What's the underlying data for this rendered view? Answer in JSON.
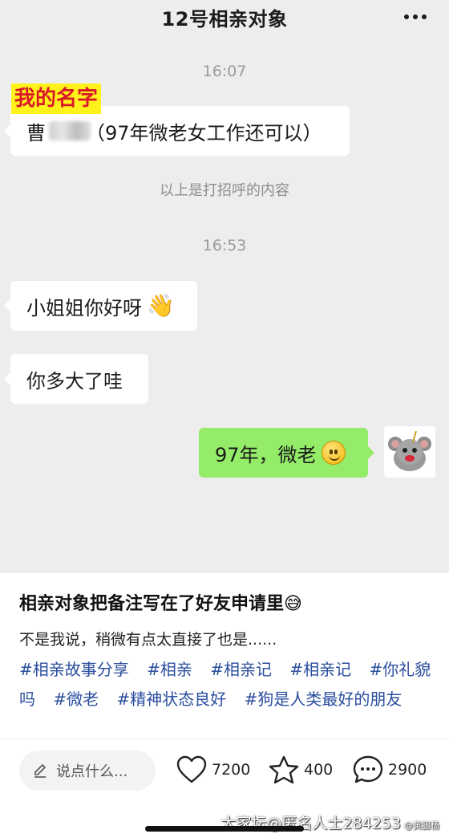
{
  "chat": {
    "title": "12号相亲对象",
    "time1": "16:07",
    "name_label": "我的名字",
    "intro_prefix": "曹",
    "intro_suffix": "（97年微老女工作还可以）",
    "system_note": "以上是打招呼的内容",
    "time2": "16:53",
    "messages": [
      {
        "side": "left",
        "text": "小姐姐你好呀"
      },
      {
        "side": "left",
        "text": "你多大了哇"
      },
      {
        "side": "right",
        "text": "97年，微老"
      }
    ]
  },
  "post": {
    "title": "相亲对象把备注写在了好友申请里😅",
    "body": "不是我说，稍微有点太直接了也是......",
    "tags": [
      "#相亲故事分享",
      "#相亲",
      "#相亲记",
      "#相亲记",
      "#你礼貌吗",
      "#微老",
      "#精神状态良好",
      "#狗是人类最好的朋友"
    ]
  },
  "footer": {
    "comment_placeholder": "说点什么...",
    "likes": "7200",
    "favorites": "400",
    "comments": "2900",
    "watermark": "大家坛@匿名人士284253",
    "watermark_small": "@黄腿杨"
  },
  "colors": {
    "chat_bg": "#ededed",
    "sent_bubble": "#95ec69",
    "tag_link": "#2a4d9e",
    "name_tag_text": "#d9182a",
    "name_tag_bg": "#fff21a"
  },
  "icons": [
    "more-icon",
    "pencil-icon",
    "heart-icon",
    "star-icon",
    "comment-icon",
    "waving-hand-icon",
    "smile-icon"
  ]
}
